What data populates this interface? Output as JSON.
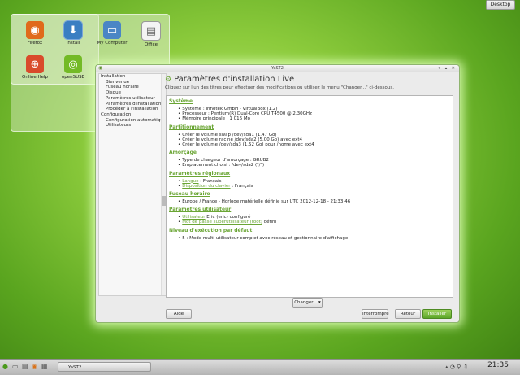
{
  "desktop_button": "Desktop",
  "desktop_icons": [
    {
      "label": "Firefox",
      "icon": "firefox-icon",
      "color": "#e06a1b"
    },
    {
      "label": "Install",
      "icon": "install-icon",
      "color": "#3a7ec2"
    },
    {
      "label": "My Computer",
      "icon": "computer-icon",
      "color": "#4a86c5"
    },
    {
      "label": "Office",
      "icon": "document-icon",
      "color": "#f4f4f4"
    },
    {
      "label": "Online Help",
      "icon": "lifebuoy-icon",
      "color": "#d94b2b"
    },
    {
      "label": "openSUSE",
      "icon": "opensuse-icon",
      "color": "#73ba25"
    }
  ],
  "window": {
    "title": "YaST2",
    "sidebar": [
      {
        "label": "Installation",
        "level": 1
      },
      {
        "label": "Bienvenue",
        "level": 2
      },
      {
        "label": "Fuseau horaire",
        "level": 2
      },
      {
        "label": "Disque",
        "level": 2
      },
      {
        "label": "Paramètres utilisateur",
        "level": 2
      },
      {
        "label": "Paramètres d'installation",
        "level": 2
      },
      {
        "label": "Procéder à l'installation",
        "level": 2
      },
      {
        "label": "Configuration",
        "level": 1
      },
      {
        "label": "Configuration automatique",
        "level": 2
      },
      {
        "label": "Utilisateurs",
        "level": 2
      }
    ],
    "header_title": "Paramètres d'installation Live",
    "header_subtitle": "Cliquez sur l'un des titres pour effectuer des modifications ou utilisez le menu \"Changer...\" ci-dessous.",
    "sections": [
      {
        "title": "Système",
        "items": [
          {
            "text": "Système : innotek GmbH - VirtualBox (1.2)"
          },
          {
            "text": "Processeur : Pentium(R) Dual-Core CPU T4500 @ 2.30GHz"
          },
          {
            "text": "Mémoire principale : 1 016 Mo"
          }
        ]
      },
      {
        "title": "Partitionnement",
        "items": [
          {
            "text": "Créer le volume swap /dev/sda1 (1.47 Go)"
          },
          {
            "text": "Créer le volume racine /dev/sda2 (5.00 Go) avec ext4"
          },
          {
            "text": "Créer le volume /dev/sda3 (1.52 Go) pour /home avec ext4"
          }
        ]
      },
      {
        "title": "Amorçage",
        "items": [
          {
            "text": "Type de chargeur d'amorçage : GRUB2"
          },
          {
            "text": "Emplacement choisi : /dev/sda2 (\"/\")"
          }
        ]
      },
      {
        "title": "Paramètres régionaux",
        "items": [
          {
            "link": "Langue",
            "text": " : Français"
          },
          {
            "link": "Disposition du clavier",
            "text": " : Français"
          }
        ]
      },
      {
        "title": "Fuseau horaire",
        "items": [
          {
            "text": "Europe / France - Horloge matérielle définie sur UTC 2012-12-18 - 21:33:46"
          }
        ]
      },
      {
        "title": "Paramètres utilisateur",
        "items": [
          {
            "link": "Utilisateur",
            "text": " Eric (eric) configuré"
          },
          {
            "link": "Mot de passe superutilisateur (root)",
            "text": " défini"
          }
        ]
      },
      {
        "title": "Niveau d'exécution par défaut",
        "items": [
          {
            "text": "5 : Mode multi-utilisateur complet avec réseau et gestionnaire d'affichage"
          }
        ]
      }
    ],
    "change_button": "Changer...",
    "buttons": {
      "help": "Aide",
      "abort": "Interrompre",
      "back": "Retour",
      "install": "Installer"
    }
  },
  "taskbar": {
    "task_label": "YaST2",
    "clock": "21:35"
  }
}
